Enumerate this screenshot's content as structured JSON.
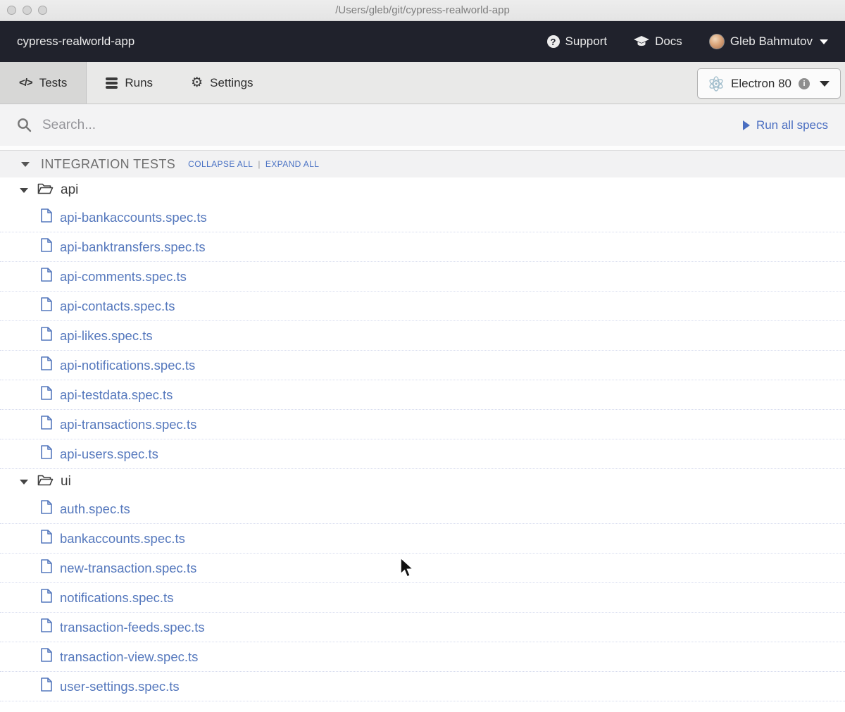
{
  "titlebar": {
    "path": "/Users/gleb/git/cypress-realworld-app"
  },
  "header": {
    "project_name": "cypress-realworld-app",
    "support_label": "Support",
    "docs_label": "Docs",
    "user_name": "Gleb Bahmutov"
  },
  "nav": {
    "tabs": [
      {
        "label": "Tests",
        "icon": "code-icon",
        "active": true
      },
      {
        "label": "Runs",
        "icon": "database-icon",
        "active": false
      },
      {
        "label": "Settings",
        "icon": "gear-icon",
        "active": false
      }
    ],
    "browser": {
      "label": "Electron 80",
      "icon": "electron-atom-icon",
      "info_icon": "info-circle-icon"
    }
  },
  "search": {
    "placeholder": "Search...",
    "icon": "search-icon"
  },
  "run_all": {
    "label": "Run all specs",
    "icon": "play-icon"
  },
  "tests_section": {
    "title": "INTEGRATION TESTS",
    "collapse_all": "COLLAPSE ALL",
    "separator": "|",
    "expand_all": "EXPAND ALL",
    "folders": [
      {
        "name": "api",
        "files": [
          "api-bankaccounts.spec.ts",
          "api-banktransfers.spec.ts",
          "api-comments.spec.ts",
          "api-contacts.spec.ts",
          "api-likes.spec.ts",
          "api-notifications.spec.ts",
          "api-testdata.spec.ts",
          "api-transactions.spec.ts",
          "api-users.spec.ts"
        ]
      },
      {
        "name": "ui",
        "files": [
          "auth.spec.ts",
          "bankaccounts.spec.ts",
          "new-transaction.spec.ts",
          "notifications.spec.ts",
          "transaction-feeds.spec.ts",
          "transaction-view.spec.ts",
          "user-settings.spec.ts"
        ]
      }
    ]
  },
  "icons": {
    "traffic_lights": "mac-window-buttons",
    "support": "question-circle-icon",
    "docs": "graduation-cap-icon",
    "user_caret": "chevron-down-icon",
    "tests_tab": "code-icon",
    "runs_tab": "database-icon",
    "settings_tab": "gear-icon",
    "browser": "electron-atom-icon",
    "folder": "folder-open-icon",
    "file": "document-icon"
  },
  "colors": {
    "header_bg": "#20222c",
    "nav_bg": "#e9e9e8",
    "active_tab_bg": "#d7d7d6",
    "search_bg": "#f3f3f4",
    "section_header_bg": "#f2f2f3",
    "link_blue": "#5578bd",
    "action_blue": "#4a6ec1",
    "collapse_blue": "#4a72c4",
    "row_separator": "#d6dbee"
  }
}
